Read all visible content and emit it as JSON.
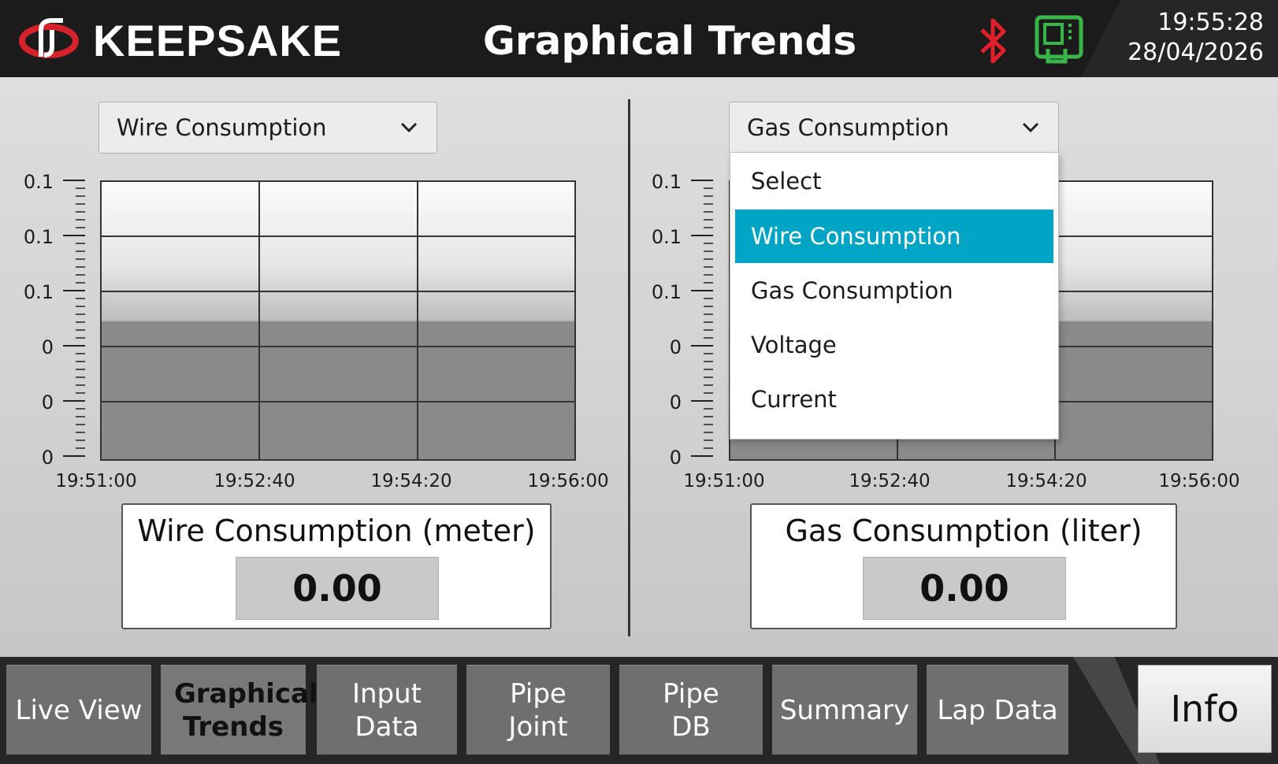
{
  "header": {
    "brand": "KEEPSAKE",
    "page_title": "Graphical Trends",
    "time": "19:55:28",
    "date": "28/04/2026",
    "icons": [
      "logo-icon",
      "bluetooth-icon",
      "device-icon"
    ],
    "colors": {
      "bluetooth": "#e0202b",
      "device": "#39b54a",
      "logo": "#d6222a"
    }
  },
  "left_panel": {
    "select_value": "Wire Consumption",
    "y_ticks": [
      "0.1",
      "0.1",
      "0.1",
      "0",
      "0",
      "0"
    ],
    "x_ticks": [
      "19:51:00",
      "19:52:40",
      "19:54:20",
      "19:56:00"
    ],
    "readout_title": "Wire Consumption (meter)",
    "readout_value": "0.00"
  },
  "right_panel": {
    "select_value": "Gas Consumption",
    "y_ticks": [
      "0.1",
      "0.1",
      "0.1",
      "0",
      "0",
      "0"
    ],
    "x_ticks": [
      "19:51:00",
      "19:52:40",
      "19:54:20",
      "19:56:00"
    ],
    "readout_title": "Gas Consumption (liter)",
    "readout_value": "0.00",
    "dropdown": {
      "options": [
        "Select",
        "Wire Consumption",
        "Gas Consumption",
        "Voltage",
        "Current"
      ],
      "highlighted": "Wire Consumption",
      "highlight_color": "#00a4c4"
    }
  },
  "nav": {
    "items": [
      {
        "label": "Live View",
        "active": false
      },
      {
        "label": "Graphical Trends",
        "active": true
      },
      {
        "label": "Input Data",
        "active": false
      },
      {
        "label": "Pipe Joint",
        "active": false
      },
      {
        "label": "Pipe DB",
        "active": false
      },
      {
        "label": "Summary",
        "active": false
      },
      {
        "label": "Lap Data",
        "active": false
      }
    ],
    "info_label": "Info"
  }
}
